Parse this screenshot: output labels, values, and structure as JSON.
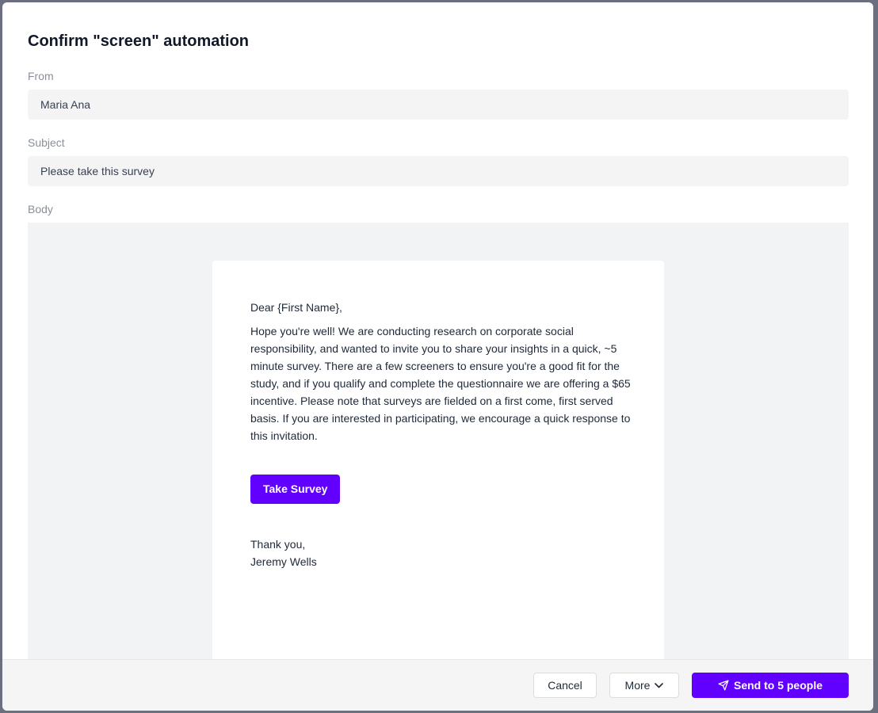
{
  "modal": {
    "title": "Confirm \"screen\" automation"
  },
  "from": {
    "label": "From",
    "value": "Maria Ana"
  },
  "subject": {
    "label": "Subject",
    "value": "Please take this survey"
  },
  "body": {
    "label": "Body",
    "greeting": "Dear {First Name},",
    "paragraph": "Hope you're well! We are conducting research on corporate social responsibility, and wanted to invite you to share your insights in a quick, ~5 minute survey. There are a few screeners to ensure you're a good fit for the study, and if you qualify and complete the questionnaire we are offering a $65 incentive. Please note that surveys are fielded on a first come, first served basis. If you are interested in participating, we encourage a quick response to this invitation.",
    "button_label": "Take Survey",
    "signoff": "Thank you,",
    "signature": "Jeremy Wells"
  },
  "footer": {
    "cancel_label": "Cancel",
    "more_label": "More",
    "send_label": "Send to 5 people"
  },
  "colors": {
    "accent": "#6200ff",
    "field_background": "#f4f4f5",
    "body_background": "#f2f3f5"
  },
  "icons": {
    "more": "chevron-down-icon",
    "send": "paper-plane-icon"
  }
}
